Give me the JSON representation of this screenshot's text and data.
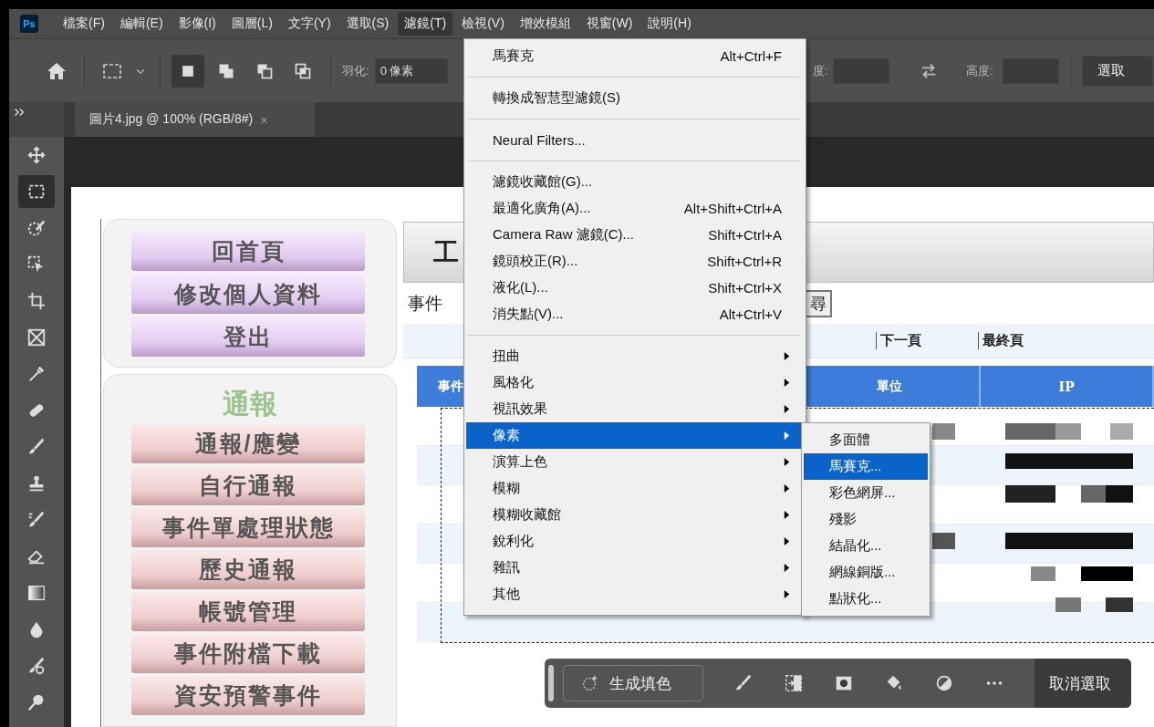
{
  "app_logo": "Ps",
  "menu_bar": [
    {
      "label": "檔案(F)",
      "selected": false
    },
    {
      "label": "編輯(E)",
      "selected": false
    },
    {
      "label": "影像(I)",
      "selected": false
    },
    {
      "label": "圖層(L)",
      "selected": false
    },
    {
      "label": "文字(Y)",
      "selected": false
    },
    {
      "label": "選取(S)",
      "selected": false
    },
    {
      "label": "濾鏡(T)",
      "selected": true
    },
    {
      "label": "檢視(V)",
      "selected": false
    },
    {
      "label": "增效模組",
      "selected": false
    },
    {
      "label": "視窗(W)",
      "selected": false
    },
    {
      "label": "說明(H)",
      "selected": false
    }
  ],
  "options_bar": {
    "selection_modes": [
      {
        "kind": "new",
        "selected": true
      },
      {
        "kind": "add",
        "selected": false
      },
      {
        "kind": "subtract",
        "selected": false
      },
      {
        "kind": "intersect",
        "selected": false
      }
    ],
    "feather_label": "羽化:",
    "feather_value": "0 像素",
    "width_label": "度:",
    "height_label": "高度:",
    "select_and_mask": "選取"
  },
  "tools": [
    {
      "kind": "move",
      "selected": false
    },
    {
      "kind": "marquee",
      "selected": true
    },
    {
      "kind": "quick-selection",
      "selected": false
    },
    {
      "kind": "object-selection",
      "selected": false
    },
    {
      "kind": "crop",
      "selected": false
    },
    {
      "kind": "frame",
      "selected": false
    },
    {
      "kind": "eyedropper",
      "selected": false
    },
    {
      "kind": "bandage",
      "selected": false
    },
    {
      "kind": "brush",
      "selected": false
    },
    {
      "kind": "stamp",
      "selected": false
    },
    {
      "kind": "history-brush",
      "selected": false
    },
    {
      "kind": "eraser",
      "selected": false
    },
    {
      "kind": "gradient",
      "selected": false
    },
    {
      "kind": "drop",
      "selected": false
    },
    {
      "kind": "smudge",
      "selected": false
    },
    {
      "kind": "dodge",
      "selected": false
    }
  ],
  "document_tab": {
    "title": "圖片4.jpg @ 100% (RGB/8#)",
    "close": "×"
  },
  "web_page": {
    "nav_top": [
      "回首頁",
      "修改個人資料",
      "登出"
    ],
    "section_title": "通報",
    "nav_section": [
      "通報/應變",
      "自行通報",
      "事件單處理狀態",
      "歷史通報",
      "帳號管理",
      "事件附檔下載",
      "資安預警事件"
    ],
    "header_title": "工",
    "query_label": "事件",
    "search_button": "尋",
    "pager": [
      "下一頁",
      "最終頁"
    ],
    "table_columns": [
      "事件",
      "單位",
      "IP"
    ]
  },
  "filter_menu": [
    {
      "kind": "item",
      "label": "馬賽克",
      "shortcut": "Alt+Ctrl+F",
      "selected": false
    },
    {
      "kind": "separator"
    },
    {
      "kind": "item",
      "label": "轉換成智慧型濾鏡(S)",
      "selected": false
    },
    {
      "kind": "separator"
    },
    {
      "kind": "item",
      "label": "Neural Filters...",
      "selected": false
    },
    {
      "kind": "separator"
    },
    {
      "kind": "item",
      "label": "濾鏡收藏館(G)...",
      "selected": false
    },
    {
      "kind": "item",
      "label": "最適化廣角(A)...",
      "shortcut": "Alt+Shift+Ctrl+A",
      "selected": false
    },
    {
      "kind": "item",
      "label": "Camera Raw 濾鏡(C)...",
      "shortcut": "Shift+Ctrl+A",
      "selected": false
    },
    {
      "kind": "item",
      "label": "鏡頭校正(R)...",
      "shortcut": "Shift+Ctrl+R",
      "selected": false
    },
    {
      "kind": "item",
      "label": "液化(L)...",
      "shortcut": "Shift+Ctrl+X",
      "selected": false
    },
    {
      "kind": "item",
      "label": "消失點(V)...",
      "shortcut": "Alt+Ctrl+V",
      "selected": false
    },
    {
      "kind": "separator"
    },
    {
      "kind": "submenu",
      "label": "扭曲",
      "selected": false
    },
    {
      "kind": "submenu",
      "label": "風格化",
      "selected": false
    },
    {
      "kind": "submenu",
      "label": "視訊效果",
      "selected": false
    },
    {
      "kind": "submenu",
      "label": "像素",
      "selected": true
    },
    {
      "kind": "submenu",
      "label": "演算上色",
      "selected": false
    },
    {
      "kind": "submenu",
      "label": "模糊",
      "selected": false
    },
    {
      "kind": "submenu",
      "label": "模糊收藏館",
      "selected": false
    },
    {
      "kind": "submenu",
      "label": "銳利化",
      "selected": false
    },
    {
      "kind": "submenu",
      "label": "雜訊",
      "selected": false
    },
    {
      "kind": "submenu",
      "label": "其他",
      "selected": false
    }
  ],
  "pixelate_submenu": [
    {
      "label": "多面體",
      "selected": false
    },
    {
      "label": "馬賽克...",
      "selected": true
    },
    {
      "label": "彩色網屏...",
      "selected": false
    },
    {
      "label": "殘影",
      "selected": false
    },
    {
      "label": "結晶化...",
      "selected": false
    },
    {
      "label": "網線銅版...",
      "selected": false
    },
    {
      "label": "點狀化...",
      "selected": false
    }
  ],
  "task_bar": {
    "generative_fill": "生成填色",
    "deselect": "取消選取"
  }
}
